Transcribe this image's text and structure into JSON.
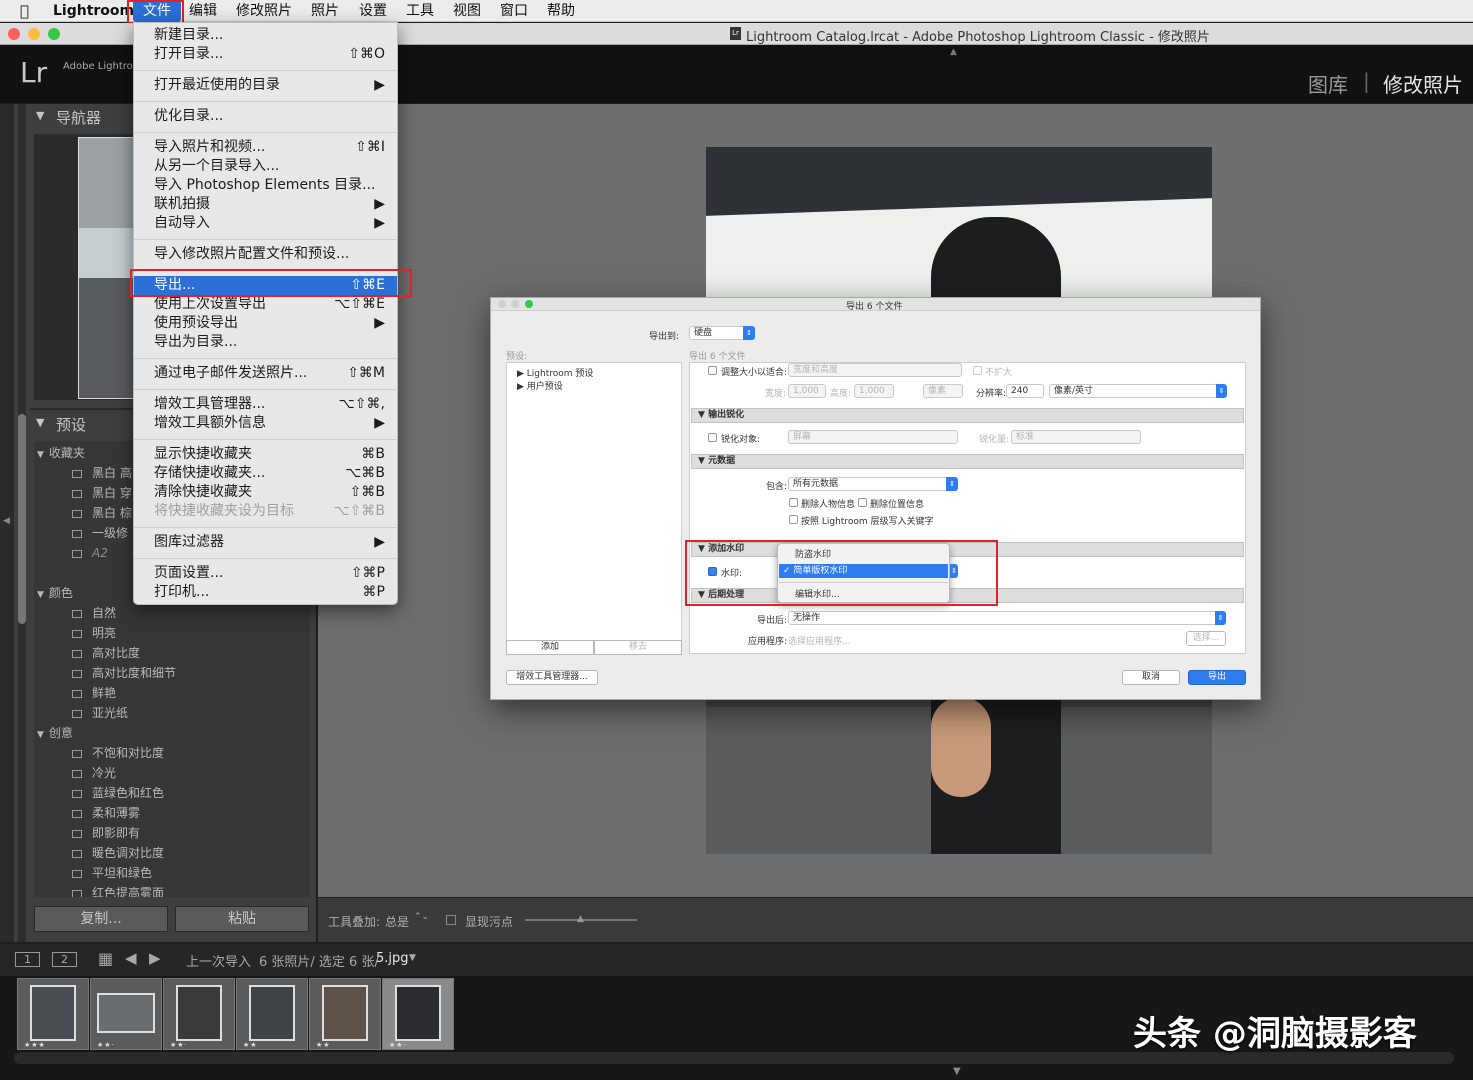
{
  "menubar": {
    "apple": "",
    "items": [
      "Lightroom",
      "文件",
      "编辑",
      "修改照片",
      "照片",
      "设置",
      "工具",
      "视图",
      "窗口",
      "帮助"
    ]
  },
  "titlebar": {
    "title": "Lightroom Catalog.lrcat - Adobe Photoshop Lightroom Classic - 修改照片",
    "icon": "Lr"
  },
  "topbar": {
    "logo": "Lr",
    "brand": "Adobe Lightroom",
    "modules": [
      "图库",
      "修改照片"
    ],
    "divider": "|"
  },
  "left_panel": {
    "navigator": {
      "title": "导航器"
    },
    "presets": {
      "title": "预设",
      "groups": [
        {
          "name": "收藏夹",
          "items": [
            "黑白 高",
            "黑白 穿",
            "黑白 棕",
            "一级修",
            "A2"
          ]
        },
        {
          "name": "颜色",
          "items": [
            "自然",
            "明亮",
            "高对比度",
            "高对比度和细节",
            "鲜艳",
            "亚光纸"
          ]
        },
        {
          "name": "创意",
          "items": [
            "不饱和对比度",
            "冷光",
            "蓝绿色和红色",
            "柔和薄雾",
            "即影即有",
            "暖色调对比度",
            "平坦和绿色",
            "红色提高雾面"
          ]
        }
      ]
    },
    "buttons": {
      "copy": "复制...",
      "paste": "粘贴"
    }
  },
  "file_menu": {
    "items": [
      {
        "label": "新建目录...",
        "shortcut": ""
      },
      {
        "label": "打开目录...",
        "shortcut": "⇧⌘O"
      },
      {
        "label": "打开最近使用的目录",
        "shortcut": "▶"
      },
      {
        "label": "优化目录...",
        "shortcut": ""
      },
      {
        "label": "导入照片和视频...",
        "shortcut": "⇧⌘I"
      },
      {
        "label": "从另一个目录导入...",
        "shortcut": ""
      },
      {
        "label": "导入 Photoshop Elements 目录...",
        "shortcut": ""
      },
      {
        "label": "联机拍摄",
        "shortcut": "▶"
      },
      {
        "label": "自动导入",
        "shortcut": "▶"
      },
      {
        "label": "导入修改照片配置文件和预设...",
        "shortcut": ""
      },
      {
        "label": "导出...",
        "shortcut": "⇧⌘E"
      },
      {
        "label": "使用上次设置导出",
        "shortcut": "⌥⇧⌘E"
      },
      {
        "label": "使用预设导出",
        "shortcut": "▶"
      },
      {
        "label": "导出为目录...",
        "shortcut": ""
      },
      {
        "label": "通过电子邮件发送照片...",
        "shortcut": "⇧⌘M"
      },
      {
        "label": "增效工具管理器...",
        "shortcut": "⌥⇧⌘,"
      },
      {
        "label": "增效工具额外信息",
        "shortcut": "▶"
      },
      {
        "label": "显示快捷收藏夹",
        "shortcut": "⌘B"
      },
      {
        "label": "存储快捷收藏夹...",
        "shortcut": "⌥⌘B"
      },
      {
        "label": "清除快捷收藏夹",
        "shortcut": "⇧⌘B"
      },
      {
        "label": "将快捷收藏夹设为目标",
        "shortcut": "⌥⇧⌘B"
      },
      {
        "label": "图库过滤器",
        "shortcut": "▶"
      },
      {
        "label": "页面设置...",
        "shortcut": "⇧⌘P"
      },
      {
        "label": "打印机...",
        "shortcut": "⌘P"
      }
    ]
  },
  "dialog": {
    "title": "导出 6 个文件",
    "export_to_label": "导出到:",
    "export_to_value": "硬盘",
    "presets_label": "预设:",
    "subtitle": "导出 6 个文件",
    "preset_tree": [
      "Lightroom 预设",
      "用户预设"
    ],
    "add": "添加",
    "remove": "移去",
    "resize": {
      "checkbox": "调整大小以适合:",
      "fit": "宽度和高度",
      "no_enlarge": "不扩大",
      "width_label": "宽度:",
      "width": "1,000",
      "height_label": "高度:",
      "height": "1,000",
      "unit": "像素",
      "res_label": "分辨率:",
      "res": "240",
      "res_unit": "像素/英寸"
    },
    "sharpen": {
      "title": "输出锐化",
      "checkbox": "锐化对象:",
      "target": "屏幕",
      "amount_label": "锐化量:",
      "amount": "标准"
    },
    "metadata": {
      "title": "元数据",
      "include_label": "包含:",
      "include": "所有元数据",
      "remove_person": "删除人物信息",
      "remove_location": "删除位置信息",
      "hierarchy": "按照 Lightroom 层级写入关键字"
    },
    "watermark": {
      "title": "添加水印",
      "checkbox": "水印:",
      "options": [
        "防盗水印",
        "简单版权水印",
        "编辑水印..."
      ],
      "check": "✓"
    },
    "post": {
      "title": "后期处理",
      "after_label": "导出后:",
      "after": "无操作",
      "app_label": "应用程序:",
      "app": "选择应用程序...",
      "choose": "选择..."
    },
    "plugin_manager": "增效工具管理器...",
    "cancel": "取消",
    "export": "导出"
  },
  "toolbar": {
    "overlay_label": "工具叠加:",
    "overlay_value": "总是",
    "spot_label": "显现污点"
  },
  "filmstrip_bar": {
    "view1": "1",
    "view2": "2",
    "source": "上一次导入",
    "count": "6 张照片/ 选定 6 张/",
    "file": "5.jpg"
  },
  "filmstrip": {
    "stars": [
      "★★★",
      "★★·",
      "★★·",
      "★★",
      "★★",
      "★★·"
    ]
  },
  "watermark_text": "头条 @洞脑摄影客",
  "colors": {
    "accent": "#2b6fd7",
    "highlight": "#e0202a"
  }
}
